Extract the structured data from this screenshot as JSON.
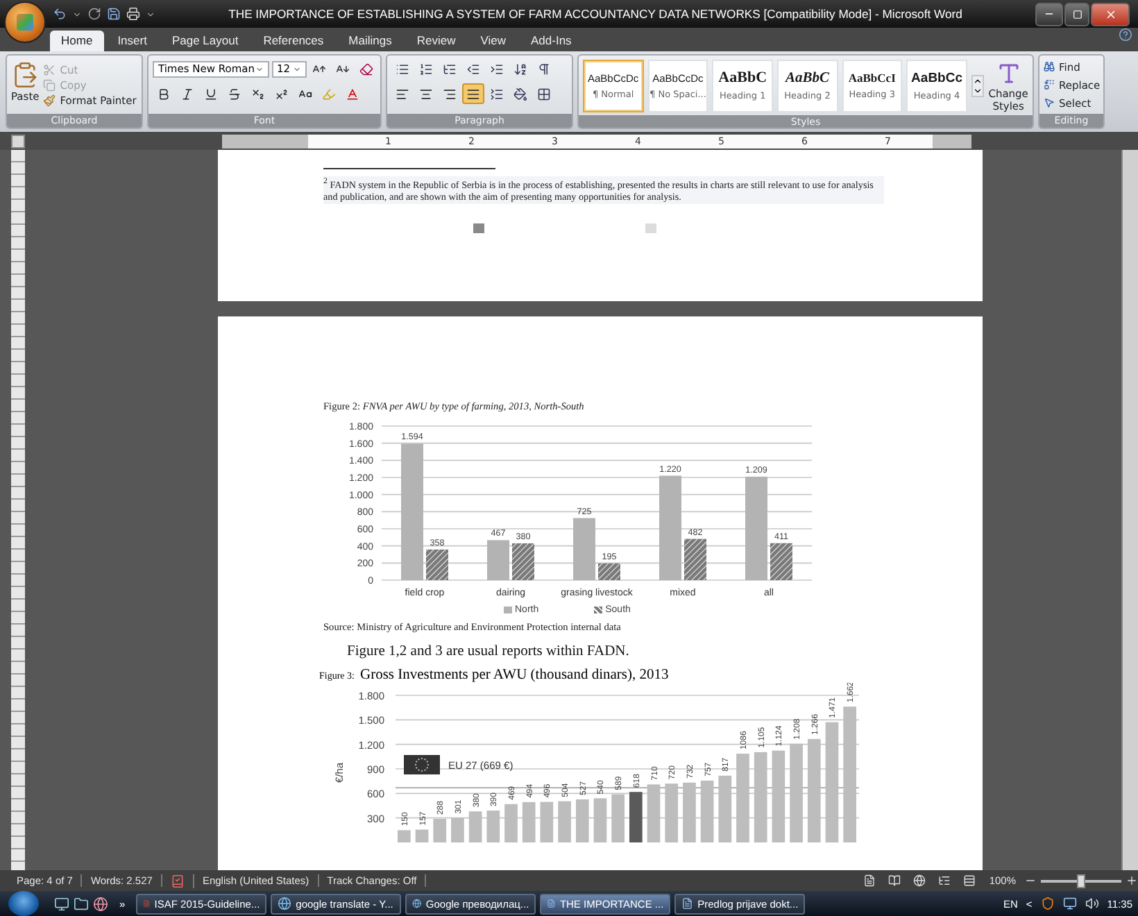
{
  "window": {
    "title": "THE IMPORTANCE OF ESTABLISHING A SYSTEM OF FARM ACCOUNTANCY DATA NETWORKS [Compatibility Mode] - Microsoft Word"
  },
  "tabs": [
    {
      "label": "Home",
      "selected": true
    },
    {
      "label": "Insert",
      "selected": false
    },
    {
      "label": "Page Layout",
      "selected": false
    },
    {
      "label": "References",
      "selected": false
    },
    {
      "label": "Mailings",
      "selected": false
    },
    {
      "label": "Review",
      "selected": false
    },
    {
      "label": "View",
      "selected": false
    },
    {
      "label": "Add-Ins",
      "selected": false
    }
  ],
  "ribbon": {
    "clipboard": {
      "label": "Clipboard",
      "paste": "Paste",
      "commands": [
        {
          "label": "Cut",
          "disabled": true
        },
        {
          "label": "Copy",
          "disabled": true
        },
        {
          "label": "Format Painter",
          "disabled": false
        }
      ]
    },
    "font": {
      "label": "Font",
      "name": "Times New Roman",
      "size": "12"
    },
    "paragraph": {
      "label": "Paragraph",
      "alignments": [
        {
          "selected": false
        },
        {
          "selected": false
        },
        {
          "selected": false
        },
        {
          "selected": true
        }
      ]
    },
    "styles": {
      "label": "Styles",
      "change": "Change Styles",
      "items": [
        {
          "kind": "normal",
          "preview": "AaBbCcDc",
          "name": "¶ Normal",
          "selected": true
        },
        {
          "kind": "nospacing",
          "preview": "AaBbCcDc",
          "name": "¶ No Spaci...",
          "selected": false
        },
        {
          "kind": "heading1",
          "preview": "AaBbC",
          "name": "Heading 1",
          "selected": false
        },
        {
          "kind": "heading2",
          "preview": "AaBbC",
          "name": "Heading 2",
          "selected": false
        },
        {
          "kind": "heading3",
          "preview": "AaBbCcI",
          "name": "Heading 3",
          "selected": false
        },
        {
          "kind": "heading4",
          "preview": "AaBbCc",
          "name": "Heading 4",
          "selected": false
        }
      ]
    },
    "editing": {
      "label": "Editing",
      "commands": [
        "Find",
        "Replace",
        "Select"
      ]
    }
  },
  "ruler": {
    "marks": [
      "1",
      "2",
      "3",
      "4",
      "5",
      "6",
      "7"
    ]
  },
  "document": {
    "footnote": "$^{2}$  FADN system in the Republic of Serbia is in the process of establishing, presented the results in charts are still relevant to use for analysis and publication, and are shown with the aim of presenting many opportunities for analysis.",
    "figure_2": {
      "caption": "Figure 2: *FNVA per AWU by type of farming, 2013, North-South*",
      "chart_data": {
        "type": "bar",
        "categories": [
          "field crop",
          "dairing",
          "grasing livestock",
          "mixed",
          "all"
        ],
        "grid": true,
        "series": [
          {
            "name": "North",
            "color": "#b3b3b3",
            "values": [
              1594,
              467,
              725,
              1220,
              1209
            ]
          },
          {
            "name": "South",
            "color": "#7a7a7a",
            "values": [
              358,
              430,
              195,
              482,
              432
            ]
          }
        ],
        "ylim": [
          0,
          1800
        ],
        "yticks": [
          {
            "value": 0,
            "label": "0"
          },
          {
            "value": 200,
            "label": "200"
          },
          {
            "value": 400,
            "label": "400"
          },
          {
            "value": 600,
            "label": "600"
          },
          {
            "value": 800,
            "label": "800"
          },
          {
            "value": 1000,
            "label": "1.000"
          },
          {
            "value": 1200,
            "label": "1.200"
          },
          {
            "value": 1400,
            "label": "1.400"
          },
          {
            "value": 1600,
            "label": "1.600"
          },
          {
            "value": 1800,
            "label": "1.800"
          }
        ],
        "value_labels": [
          [
            "1.594",
            "467",
            "725",
            "1.220",
            "1.209"
          ],
          [
            "358",
            "380",
            "195",
            "482",
            "411"
          ]
        ]
      }
    },
    "source": "Source: Ministry of Agriculture  and Environment Protection internal data",
    "note": "Figure 1,2 and 3 are usual reports within FADN.",
    "figure_3": {
      "number": "Figure 3:",
      "title": "Gross Investments per AWU (thousand dinars), 2013",
      "chart_data": {
        "type": "bar",
        "stacked": true,
        "grid": true,
        "ylabel": "€/ha",
        "ylim": [
          0,
          1800
        ],
        "yticks": [
          {
            "value": 300,
            "label": "300"
          },
          {
            "value": 600,
            "label": "600"
          },
          {
            "value": 900,
            "label": "900"
          },
          {
            "value": 1200,
            "label": "1.200"
          },
          {
            "value": 1500,
            "label": "1.500"
          },
          {
            "value": 1800,
            "label": "1.800"
          }
        ],
        "series": [
          {
            "color": "#bdbdbd",
            "values": [
              150,
              157,
              288,
              301,
              380,
              390,
              469,
              494,
              496,
              504,
              527,
              540,
              589,
              null,
              710,
              720,
              732,
              757,
              817,
              1086,
              1105,
              1124,
              1208,
              1266,
              1471,
              1662
            ]
          },
          {
            "color": "#5a5a5a",
            "values": [
              null,
              null,
              null,
              null,
              null,
              null,
              null,
              null,
              null,
              null,
              null,
              null,
              null,
              618,
              null,
              null,
              null,
              null,
              null,
              null,
              null,
              null,
              null,
              null,
              null,
              null
            ]
          }
        ],
        "value_labels": [
          "150",
          "157",
          "288",
          "301",
          "380",
          "390",
          "469",
          "494",
          "496",
          "504",
          "527",
          "540",
          "589",
          "618",
          "710",
          "720",
          "732",
          "757",
          "817",
          "1086",
          "1.105",
          "1.124",
          "1.208",
          "1.266",
          "1.471",
          "1.662"
        ],
        "ref_lines": [
          {
            "axis": "y",
            "value": 669,
            "label": "EU 27 (669 €)",
            "color": "#9a9a9a"
          }
        ]
      }
    }
  },
  "status_bar": {
    "page": "Page: 4 of 7",
    "words": "Words: 2.527",
    "language": "English (United States)",
    "track_changes": "Track Changes: Off",
    "zoom": "100%",
    "zoom_slider": {
      "level": 0.5
    }
  },
  "taskbar": {
    "more": "»",
    "tasks": [
      {
        "label": "ISAF 2015-Guideline...",
        "kind": "pdf",
        "selected": false
      },
      {
        "label": "google translate - Y...",
        "kind": "browser",
        "selected": false
      },
      {
        "label": "Google преводилац...",
        "kind": "browser",
        "selected": false
      },
      {
        "label": "THE IMPORTANCE ...",
        "kind": "word",
        "selected": true
      },
      {
        "label": "Predlog prijave dokt...",
        "kind": "word",
        "selected": false
      }
    ],
    "language": "EN",
    "tray_expand": "<",
    "clock": "11:35"
  }
}
